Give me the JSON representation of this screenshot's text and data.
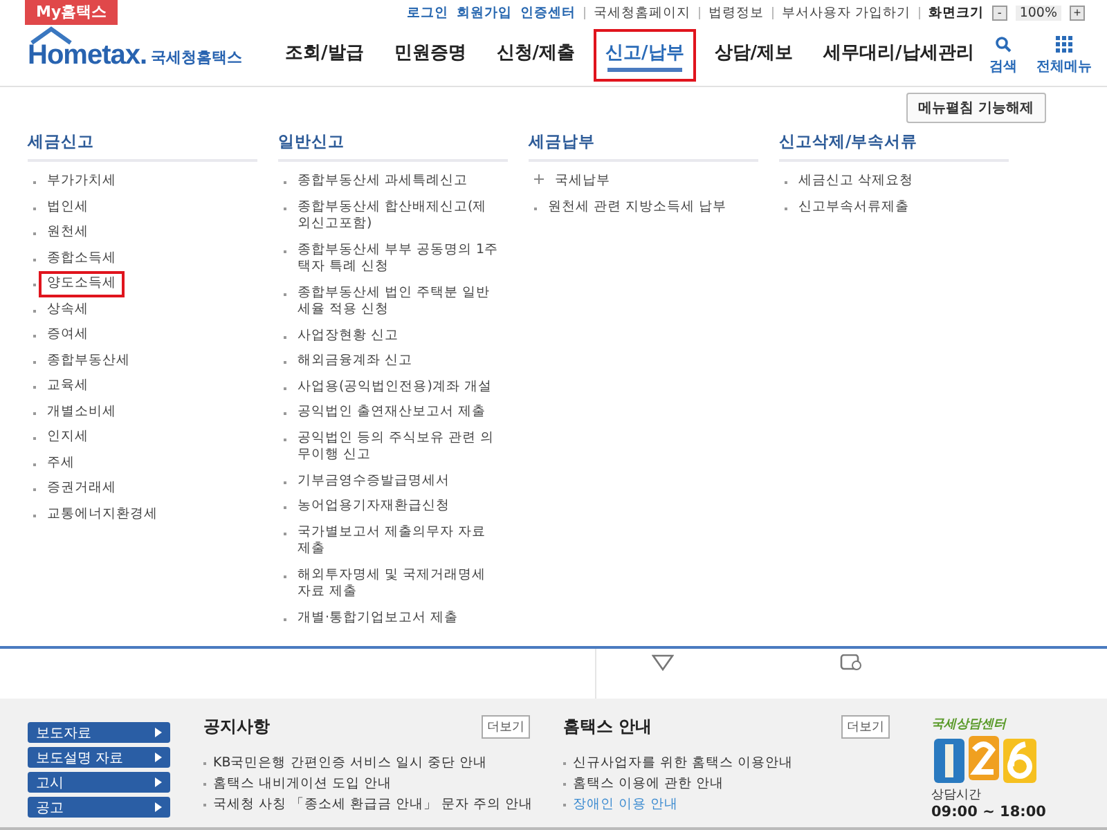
{
  "top_bar": {
    "my_tab": "My홈택스",
    "links": [
      {
        "label": "로그인",
        "kind": "primary"
      },
      {
        "label": "회원가입",
        "kind": "primary"
      },
      {
        "label": "인증센터",
        "kind": "primary"
      },
      {
        "label": "국세청홈페이지",
        "kind": "secondary"
      },
      {
        "label": "법령정보",
        "kind": "secondary"
      },
      {
        "label": "부서사용자 가입하기",
        "kind": "secondary"
      }
    ],
    "zoom": {
      "label": "화면크기",
      "minus": "-",
      "value": "100%",
      "plus": "+"
    }
  },
  "logo": {
    "wordmark": "Hometax.",
    "name": "국세청홈택스"
  },
  "nav": [
    {
      "label": "조회/발급",
      "selected": false,
      "highlighted": false
    },
    {
      "label": "민원증명",
      "selected": false,
      "highlighted": false
    },
    {
      "label": "신청/제출",
      "selected": false,
      "highlighted": false
    },
    {
      "label": "신고/납부",
      "selected": true,
      "highlighted": true
    },
    {
      "label": "상담/제보",
      "selected": false,
      "highlighted": false
    },
    {
      "label": "세무대리/납세관리",
      "selected": false,
      "highlighted": false
    }
  ],
  "tools": [
    {
      "label": "검색",
      "kind": "search"
    },
    {
      "label": "전체메뉴",
      "kind": "grid"
    }
  ],
  "menu_pin_button": "메뉴펼침 기능해제",
  "columns": [
    {
      "title": "세금신고",
      "items": [
        {
          "label": "부가가치세",
          "kind": "link",
          "highlighted": false
        },
        {
          "label": "법인세",
          "kind": "link",
          "highlighted": false
        },
        {
          "label": "원천세",
          "kind": "link",
          "highlighted": false
        },
        {
          "label": "종합소득세",
          "kind": "link",
          "highlighted": false
        },
        {
          "label": "양도소득세",
          "kind": "link",
          "highlighted": true
        },
        {
          "label": "상속세",
          "kind": "link",
          "highlighted": false
        },
        {
          "label": "증여세",
          "kind": "link",
          "highlighted": false
        },
        {
          "label": "종합부동산세",
          "kind": "link",
          "highlighted": false
        },
        {
          "label": "교육세",
          "kind": "link",
          "highlighted": false
        },
        {
          "label": "개별소비세",
          "kind": "link",
          "highlighted": false
        },
        {
          "label": "인지세",
          "kind": "link",
          "highlighted": false
        },
        {
          "label": "주세",
          "kind": "link",
          "highlighted": false
        },
        {
          "label": "증권거래세",
          "kind": "link",
          "highlighted": false
        },
        {
          "label": "교통에너지환경세",
          "kind": "link",
          "highlighted": false
        }
      ]
    },
    {
      "title": "일반신고",
      "items": [
        {
          "label": "종합부동산세 과세특례신고",
          "kind": "link",
          "highlighted": false
        },
        {
          "label": "종합부동산세 합산배제신고(제외신고포함)",
          "kind": "link",
          "highlighted": false
        },
        {
          "label": "종합부동산세 부부 공동명의 1주택자 특례 신청",
          "kind": "link",
          "highlighted": false
        },
        {
          "label": "종합부동산세 법인 주택분 일반세율 적용 신청",
          "kind": "link",
          "highlighted": false
        },
        {
          "label": "사업장현황 신고",
          "kind": "link",
          "highlighted": false
        },
        {
          "label": "해외금융계좌 신고",
          "kind": "link",
          "highlighted": false
        },
        {
          "label": "사업용(공익법인전용)계좌 개설",
          "kind": "link",
          "highlighted": false
        },
        {
          "label": "공익법인 출연재산보고서 제출",
          "kind": "link",
          "highlighted": false
        },
        {
          "label": "공익법인 등의 주식보유 관련 의무이행 신고",
          "kind": "link",
          "highlighted": false
        },
        {
          "label": "기부금영수증발급명세서",
          "kind": "link",
          "highlighted": false
        },
        {
          "label": "농어업용기자재환급신청",
          "kind": "link",
          "highlighted": false
        },
        {
          "label": "국가별보고서 제출의무자 자료 제출",
          "kind": "link",
          "highlighted": false
        },
        {
          "label": "해외투자명세 및 국제거래명세 자료 제출",
          "kind": "link",
          "highlighted": false
        },
        {
          "label": "개별·통합기업보고서 제출",
          "kind": "link",
          "highlighted": false
        }
      ]
    },
    {
      "title": "세금납부",
      "items": [
        {
          "label": "국세납부",
          "kind": "group",
          "highlighted": false
        },
        {
          "label": "원천세 관련 지방소득세 납부",
          "kind": "link",
          "highlighted": false
        }
      ]
    },
    {
      "title": "신고삭제/부속서류",
      "items": [
        {
          "label": "세금신고 삭제요청",
          "kind": "link",
          "highlighted": false
        },
        {
          "label": "신고부속서류제출",
          "kind": "link",
          "highlighted": false
        }
      ]
    }
  ],
  "footer": {
    "side_buttons": [
      "보도자료",
      "보도설명 자료",
      "고시",
      "공고"
    ],
    "boards": [
      {
        "title": "공지사항",
        "more": "더보기",
        "items": [
          {
            "label": "KB국민은행 간편인증 서비스 일시 중단 안내",
            "kind": "normal"
          },
          {
            "label": "홈택스 내비게이션 도입 안내",
            "kind": "normal"
          },
          {
            "label": "국세청 사칭 「종소세 환급금 안내」 문자 주의 안내",
            "kind": "normal"
          }
        ]
      },
      {
        "title": "홈택스 안내",
        "more": "더보기",
        "items": [
          {
            "label": "신규사업자를 위한 홈택스 이용안내",
            "kind": "normal"
          },
          {
            "label": "홈택스 이용에 관한 안내",
            "kind": "normal"
          },
          {
            "label": "장애인 이용 안내",
            "kind": "accent"
          }
        ]
      }
    ],
    "center": {
      "title": "국세상담센터",
      "hours_label": "상담시간",
      "hours": "09:00 ~ 18:00"
    }
  }
}
